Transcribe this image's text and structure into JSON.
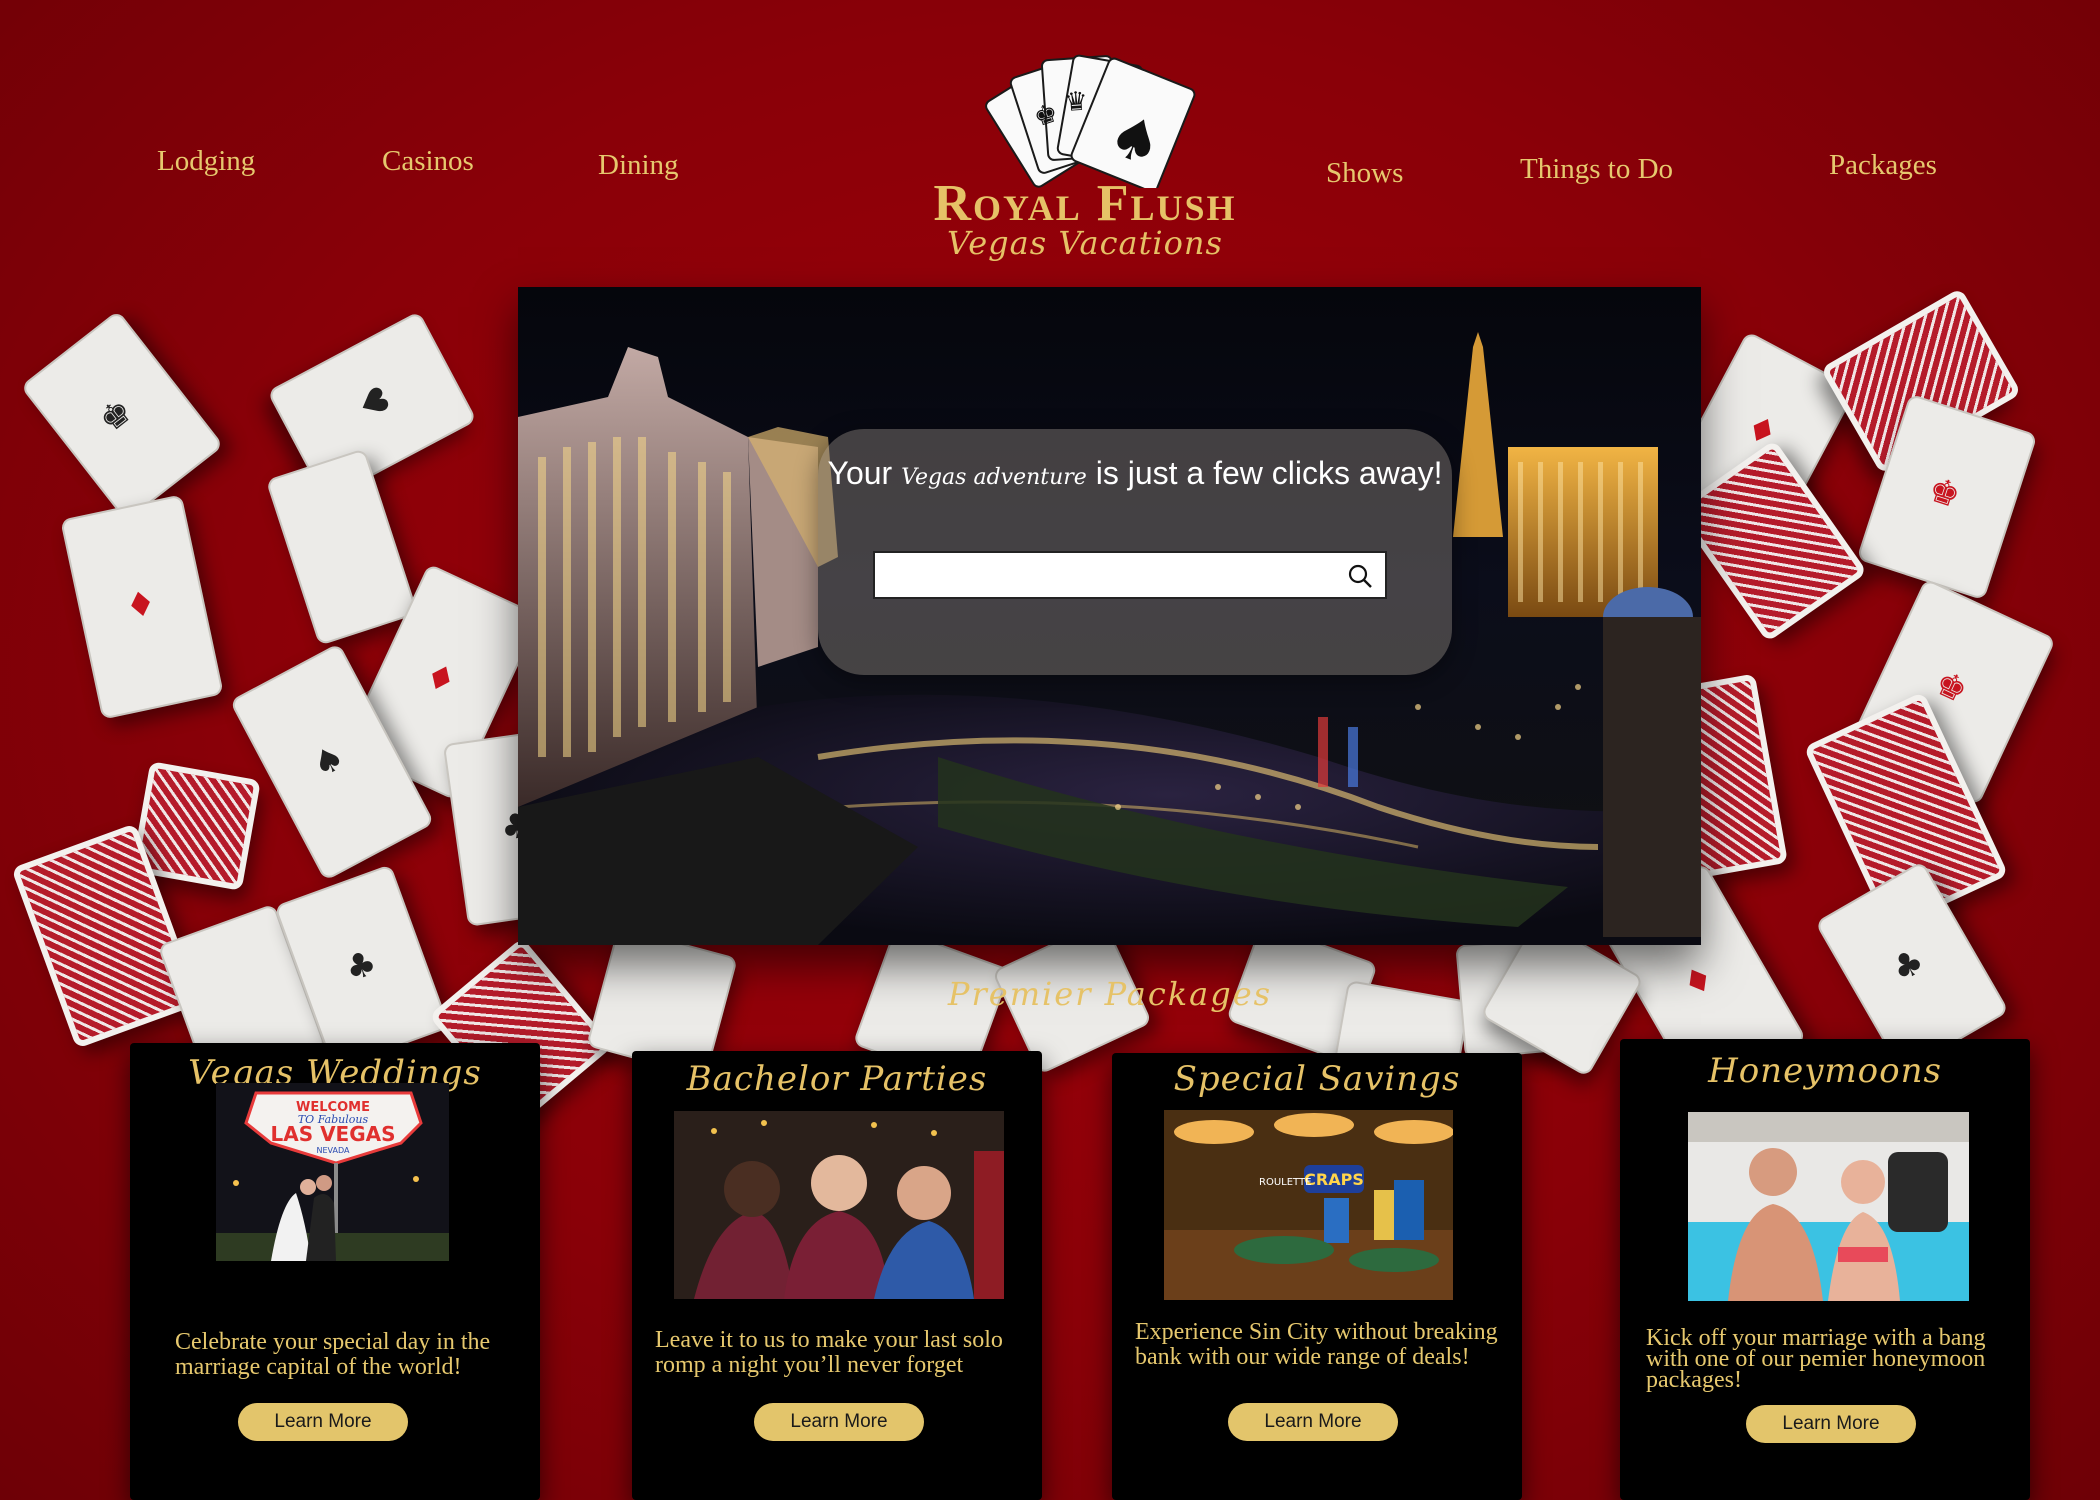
{
  "nav": {
    "left": [
      "Lodging",
      "Casinos",
      "Dining"
    ],
    "right": [
      "Shows",
      "Things to Do",
      "Packages"
    ]
  },
  "logo": {
    "title": "Royal Flush",
    "subtitle": "Vegas Vacations"
  },
  "hero": {
    "tagline_prefix": "Your",
    "tagline_script": "Vegas adventure",
    "tagline_suffix": "is just a few clicks away!",
    "search_value": "",
    "search_placeholder": ""
  },
  "section_title": "Premier Packages",
  "packages": [
    {
      "title": "Vegas Weddings",
      "description": "Celebrate your special day in the marriage capital of the world!",
      "button": "Learn More",
      "sign_line1": "WELCOME",
      "sign_line2": "TO Fabulous",
      "sign_line3": "LAS VEGAS",
      "sign_line4": "NEVADA"
    },
    {
      "title": "Bachelor Parties",
      "description": "Leave it to us to make your last solo romp a night you’ll never forget",
      "button": "Learn More"
    },
    {
      "title": "Special Savings",
      "description": "Experience Sin City without breaking bank with our wide range of deals!",
      "button": "Learn More",
      "sign_roulette": "ROULETTE",
      "sign_craps": "CRAPS"
    },
    {
      "title": "Honeymoons",
      "description": "Kick off your marriage with a bang with one of our pemier honeymoon packages!",
      "button": "Learn More"
    }
  ],
  "colors": {
    "background": "#8a0008",
    "gold": "#e6c267",
    "button": "#e3c56b",
    "card_bg": "#000000"
  }
}
